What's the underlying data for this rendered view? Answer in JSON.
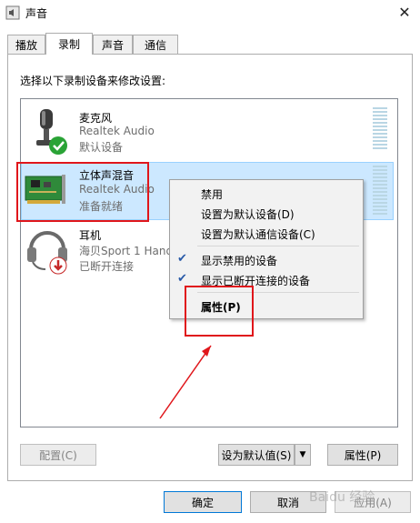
{
  "window": {
    "title": "声音",
    "close_icon": "close-icon"
  },
  "tabs": [
    {
      "label": "播放"
    },
    {
      "label": "录制"
    },
    {
      "label": "声音"
    },
    {
      "label": "通信"
    }
  ],
  "instruction": "选择以下录制设备来修改设置:",
  "devices": [
    {
      "name": "麦克风",
      "driver": "Realtek Audio",
      "status": "默认设备",
      "icon": "microphone-icon",
      "badge": "green-check"
    },
    {
      "name": "立体声混音",
      "driver": "Realtek Audio",
      "status": "准备就绪",
      "icon": "sound-card-icon"
    },
    {
      "name": "耳机",
      "driver": "海贝Sport 1 Hand",
      "status": "已断开连接",
      "icon": "headset-icon",
      "badge": "red-down-arrow"
    }
  ],
  "context_menu": {
    "items": [
      {
        "label": "禁用"
      },
      {
        "label": "设置为默认设备(D)"
      },
      {
        "label": "设置为默认通信设备(C)"
      },
      {
        "label": "显示禁用的设备",
        "checked": true
      },
      {
        "label": "显示已断开连接的设备",
        "checked": true
      },
      {
        "label": "属性(P)",
        "bold": true
      }
    ]
  },
  "buttons": {
    "configure": "配置(C)",
    "set_default": "设为默认值(S)",
    "properties": "属性(P)",
    "ok": "确定",
    "cancel": "取消",
    "apply": "应用(A)"
  },
  "watermark": "Baidu 经验",
  "colors": {
    "selection": "#cce8ff",
    "annotation_red": "#e0161b",
    "check_blue": "#2a5ba8"
  }
}
